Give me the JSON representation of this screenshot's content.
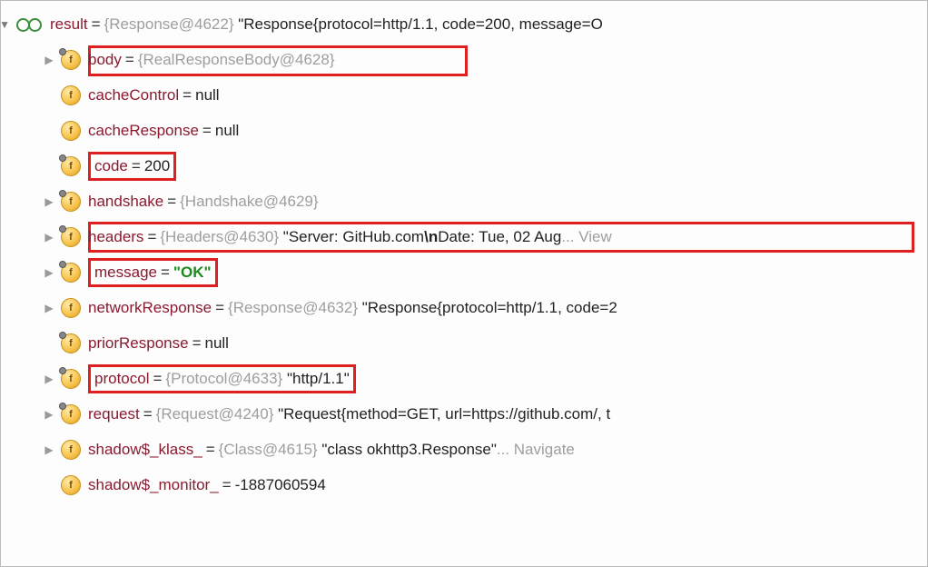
{
  "root": {
    "name": "result",
    "type": "{Response@4622}",
    "value": "\"Response{protocol=http/1.1, code=200, message=O"
  },
  "rows": [
    {
      "arrow": "▶",
      "pin": true,
      "letter": "f",
      "name": "body",
      "type": "{RealResponseBody@4628}",
      "value": "",
      "highlight": "wide-body"
    },
    {
      "arrow": "",
      "pin": false,
      "letter": "f",
      "name": "cacheControl",
      "type": "",
      "value": "null",
      "highlight": ""
    },
    {
      "arrow": "",
      "pin": false,
      "letter": "f",
      "name": "cacheResponse",
      "type": "",
      "value": "null",
      "highlight": ""
    },
    {
      "arrow": "",
      "pin": true,
      "letter": "f",
      "name": "code",
      "type": "",
      "value": "200",
      "highlight": "box",
      "hl_text": "code = 200"
    },
    {
      "arrow": "▶",
      "pin": true,
      "letter": "f",
      "name": "handshake",
      "type": "{Handshake@4629}",
      "value": "",
      "highlight": ""
    },
    {
      "arrow": "▶",
      "pin": true,
      "letter": "f",
      "name": "headers",
      "type": "{Headers@4630}",
      "value": "\"Server: GitHub.com\\nDate: Tue, 02 Aug",
      "tail": " ... View",
      "highlight": "wide-headers"
    },
    {
      "arrow": "▶",
      "pin": true,
      "letter": "f",
      "name": "message",
      "type": "",
      "value_green": "\"OK\"",
      "highlight": "box-msg"
    },
    {
      "arrow": "▶",
      "pin": false,
      "letter": "f",
      "name": "networkResponse",
      "type": "{Response@4632}",
      "value": "\"Response{protocol=http/1.1, code=2",
      "highlight": ""
    },
    {
      "arrow": "",
      "pin": true,
      "letter": "f",
      "name": "priorResponse",
      "type": "",
      "value": "null",
      "highlight": ""
    },
    {
      "arrow": "▶",
      "pin": true,
      "letter": "f",
      "name": "protocol",
      "type": "{Protocol@4633}",
      "value": "\"http/1.1\"",
      "highlight": "box-proto"
    },
    {
      "arrow": "▶",
      "pin": true,
      "letter": "f",
      "name": "request",
      "type": "{Request@4240}",
      "value": "\"Request{method=GET, url=https://github.com/, t",
      "highlight": ""
    },
    {
      "arrow": "▶",
      "pin": false,
      "letter": "f",
      "name": "shadow$_klass_",
      "type": "{Class@4615}",
      "value": "\"class okhttp3.Response\"",
      "tail": " ... Navigate",
      "highlight": ""
    },
    {
      "arrow": "",
      "pin": false,
      "letter": "f",
      "name": "shadow$_monitor_",
      "type": "",
      "value": "-1887060594",
      "highlight": ""
    }
  ],
  "esc": "\\n"
}
